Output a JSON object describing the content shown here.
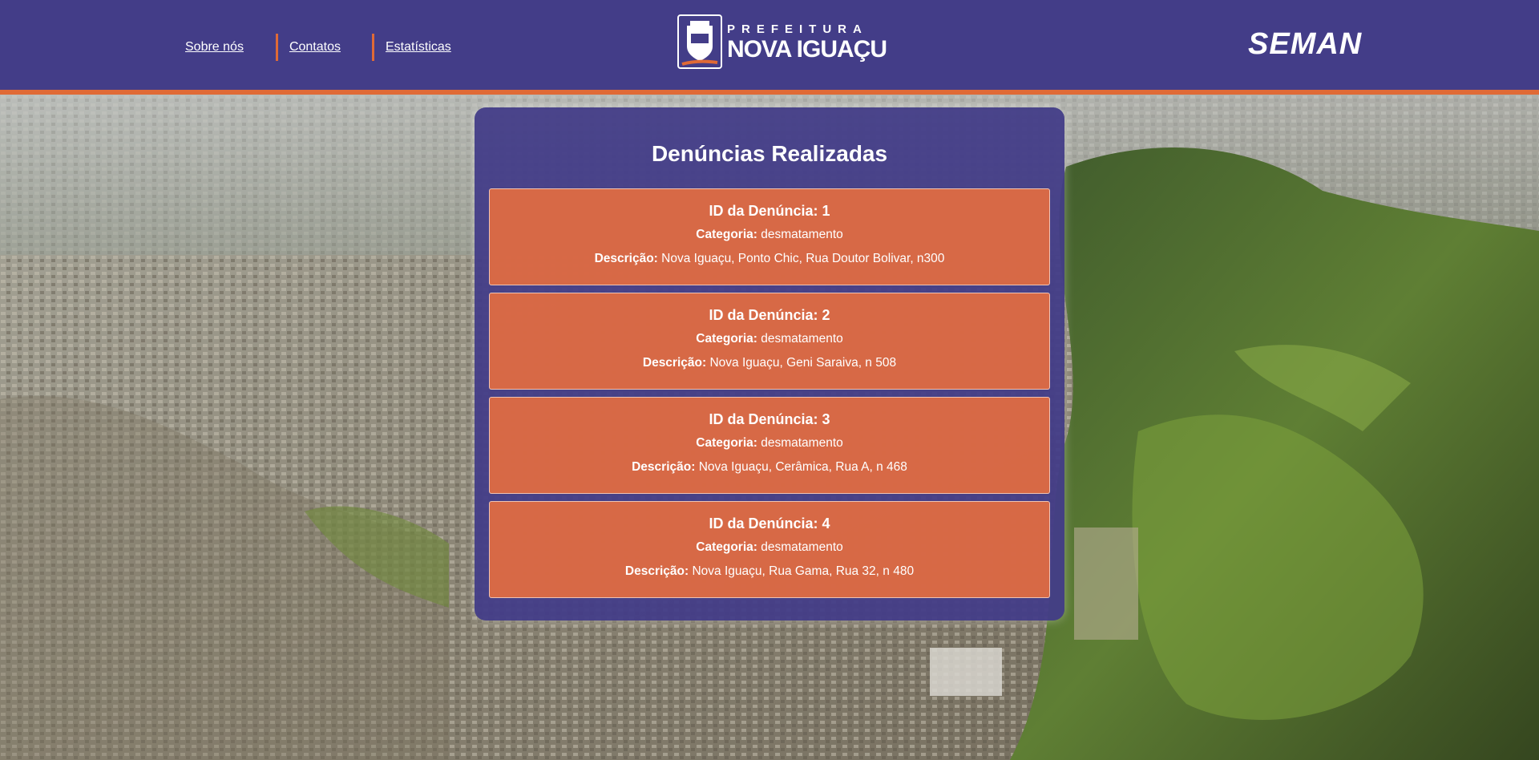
{
  "nav": {
    "about": "Sobre nós",
    "contacts": "Contatos",
    "stats": "Estatísticas"
  },
  "logo": {
    "top": "PREFEITURA",
    "bottom": "NOVA IGUAÇU"
  },
  "brand_right": "SEMAN",
  "panel": {
    "title": "Denúncias Realizadas",
    "id_label": "ID da Denúncia:",
    "category_label": "Categoria:",
    "description_label": "Descrição:",
    "items": [
      {
        "id": "1",
        "category": "desmatamento",
        "description": "Nova Iguaçu, Ponto Chic, Rua Doutor Bolivar, n300"
      },
      {
        "id": "2",
        "category": "desmatamento",
        "description": "Nova Iguaçu, Geni Saraiva, n 508"
      },
      {
        "id": "3",
        "category": "desmatamento",
        "description": "Nova Iguaçu, Cerâmica, Rua A, n 468"
      },
      {
        "id": "4",
        "category": "desmatamento",
        "description": "Nova Iguaçu, Rua Gama, Rua 32, n 480"
      }
    ]
  },
  "colors": {
    "header": "#433d88",
    "accent": "#e06a36",
    "card": "#e46c40"
  }
}
